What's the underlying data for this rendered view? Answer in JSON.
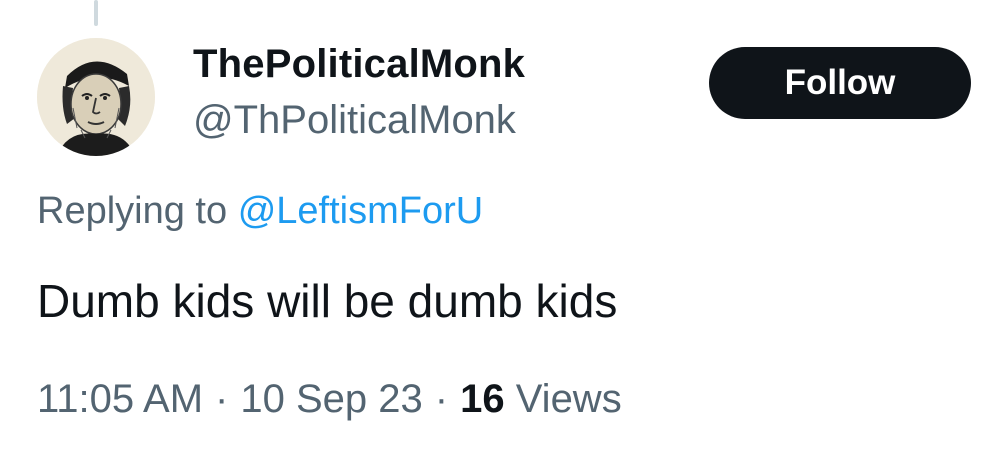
{
  "author": {
    "display_name": "ThePoliticalMonk",
    "handle": "@ThPoliticalMonk",
    "avatar_icon": "portrait-avatar"
  },
  "follow_button": {
    "label": "Follow"
  },
  "reply": {
    "prefix": "Replying to",
    "mention": "@LeftismForU"
  },
  "tweet": {
    "text": "Dumb kids will be dumb kids"
  },
  "meta": {
    "time": "11:05 AM",
    "separator": "·",
    "date": "10 Sep 23",
    "views_count": "16",
    "views_label": "Views"
  },
  "colors": {
    "primary_text": "#0f1419",
    "secondary_text": "#536471",
    "link": "#1d9bf0",
    "button_bg": "#0f1419",
    "thread_line": "#cfd9de"
  }
}
